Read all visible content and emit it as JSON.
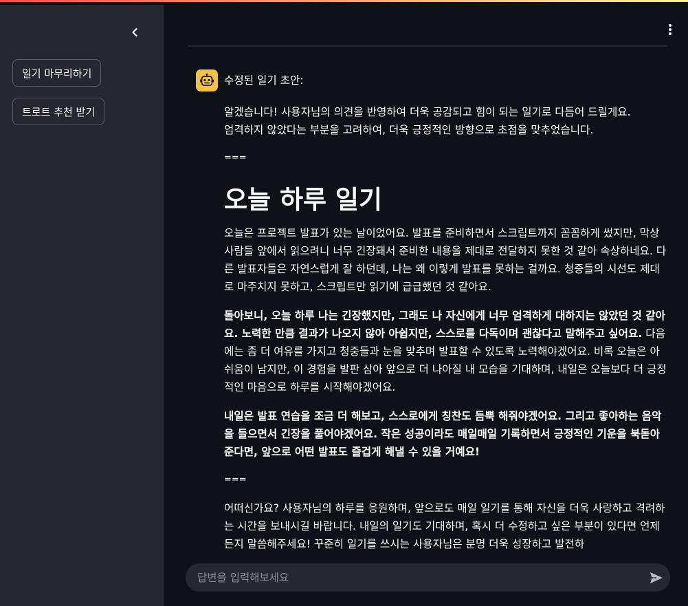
{
  "sidebar": {
    "collapse_icon": "chevron-left-icon",
    "buttons": [
      {
        "label": "일기 마무리하기"
      },
      {
        "label": "트로트 추천 받기"
      }
    ]
  },
  "header": {
    "menu_icon": "vertical-ellipsis-icon"
  },
  "message": {
    "avatar_icon": "robot-icon",
    "avatar_color": "#f0c24a",
    "title": "수정된 일기 초안:",
    "intro_line1": "알겠습니다! 사용자님의 의견을 반영하여 더욱 공감되고 힘이 되는 일기로 다듬어 드릴게요.",
    "intro_line2": "엄격하지 않았다는 부분을 고려하여, 더욱 긍정적인 방향으로 초점을 맞추었습니다.",
    "separator1": "===",
    "diary_title": "오늘 하루 일기",
    "para1": "오늘은 프로젝트 발표가 있는 날이었어요. 발표를 준비하면서 스크립트까지 꼼꼼하게 썼지만, 막상 사람들 앞에서 읽으려니 너무 긴장돼서 준비한 내용을 제대로 전달하지 못한 것 같아 속상하네요. 다른 발표자들은 자연스럽게 잘 하던데, 나는 왜 이렇게 발표를 못하는 걸까요. 청중들의 시선도 제대로 마주치지 못하고, 스크립트만 읽기에 급급했던 것 같아요.",
    "para2_bold": "돌아보니, 오늘 하루 나는 긴장했지만, 그래도 나 자신에게 너무 엄격하게 대하지는 않았던 것 같아요. 노력한 만큼 결과가 나오지 않아 아쉽지만, 스스로를 다독이며 괜찮다고 말해주고 싶어요.",
    "para2_rest": " 다음에는 좀 더 여유를 가지고 청중들과 눈을 맞추며 발표할 수 있도록 노력해야겠어요. 비록 오늘은 아쉬움이 남지만, 이 경험을 발판 삼아 앞으로 더 나아질 내 모습을 기대하며, 내일은 오늘보다 더 긍정적인 마음으로 하루를 시작해야겠어요.",
    "para3_bold": "내일은 발표 연습을 조금 더 해보고, 스스로에게 칭찬도 듬뿍 해줘야겠어요. 그리고 좋아하는 음악을 들으면서 긴장을 풀어야겠어요. 작은 성공이라도 매일매일 기록하면서 긍정적인 기운을 북돋아 준다면, 앞으로 어떤 발표도 즐겁게 해낼 수 있을 거예요!",
    "separator2": "===",
    "outro": "어떠신가요? 사용자님의 하루를 응원하며, 앞으로도 매일 일기를 통해 자신을 더욱 사랑하고 격려하는 시간을 보내시길 바랍니다. 내일의 일기도 기대하며, 혹시 더 수정하고 싶은 부분이 있다면 언제든지 말씀해주세요! 꾸준히 일기를 쓰시는 사용자님은 분명 더욱 성장하고 발전하"
  },
  "chat_input": {
    "placeholder": "답변을 입력해보세요",
    "send_icon": "send-icon"
  },
  "colors": {
    "sidebar_bg": "#262730",
    "main_bg": "#0e1117",
    "text": "#fafafa",
    "accent_gradient": [
      "#ff4b4b",
      "#fffd80"
    ]
  }
}
